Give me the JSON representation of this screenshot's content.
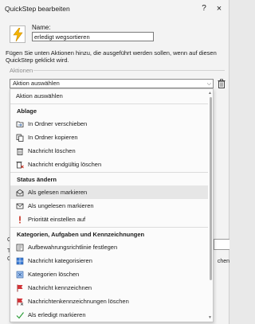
{
  "window": {
    "title": "QuickStep bearbeiten",
    "help_glyph": "?",
    "close_glyph": "×"
  },
  "name": {
    "label": "Name:",
    "value": "erledigt wegsortieren"
  },
  "instructions": "Fügen Sie unten Aktionen hinzu, die ausgeführt werden sollen, wenn auf diesen QuickStep geklickt wird.",
  "actions_section": "Aktionen",
  "select": {
    "value": "Aktion auswählen",
    "chevron": "⌵"
  },
  "dropdown": {
    "first": "Aktion auswählen",
    "groups": [
      {
        "header": "Ablage",
        "items": [
          {
            "label": "In Ordner verschieben",
            "icon": "move-to-folder-icon"
          },
          {
            "label": "In Ordner kopieren",
            "icon": "copy-to-folder-icon"
          },
          {
            "label": "Nachricht löschen",
            "icon": "delete-icon"
          },
          {
            "label": "Nachricht endgültig löschen",
            "icon": "permanent-delete-icon"
          }
        ]
      },
      {
        "header": "Status ändern",
        "items": [
          {
            "label": "Als gelesen markieren",
            "icon": "open-envelope-icon"
          },
          {
            "label": "Als ungelesen markieren",
            "icon": "closed-envelope-icon"
          },
          {
            "label": "Priorität einstellen auf",
            "icon": "exclamation-icon"
          }
        ]
      },
      {
        "header": "Kategorien, Aufgaben und Kennzeichnungen",
        "items": [
          {
            "label": "Aufbewahrungsrichtlinie festlegen",
            "icon": "retention-policy-icon"
          },
          {
            "label": "Nachricht kategorisieren",
            "icon": "categorize-icon"
          },
          {
            "label": "Kategorien löschen",
            "icon": "clear-categories-icon"
          },
          {
            "label": "Nachricht kennzeichnen",
            "icon": "flag-icon"
          },
          {
            "label": "Nachrichtenkennzeichnungen löschen",
            "icon": "clear-flag-icon"
          },
          {
            "label": "Als erledigt markieren",
            "icon": "checkmark-icon"
          }
        ]
      }
    ]
  },
  "peek": {
    "left_a": "C",
    "left_b": "T",
    "left_c": "C",
    "button_text": "chen"
  },
  "colors": {
    "bolt": "#f5b400",
    "flag": "#d13438",
    "check": "#2e9e3a",
    "priority": "#c42b1c",
    "envelope_blue": "#2b5d9e",
    "category": "#3a7bd5"
  }
}
